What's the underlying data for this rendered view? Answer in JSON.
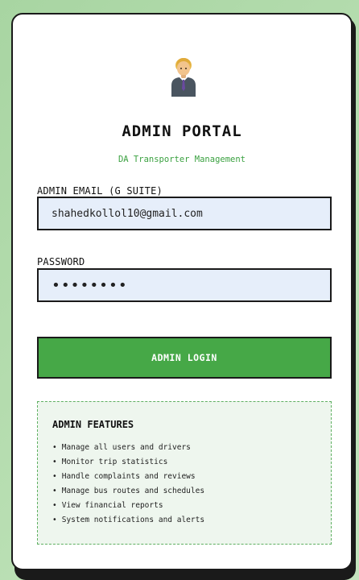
{
  "header": {
    "avatar_icon": "office-worker-icon",
    "title": "ADMIN PORTAL",
    "subtitle": "DA Transporter Management"
  },
  "form": {
    "email_label": "ADMIN EMAIL (G SUITE)",
    "email_value": "shahedkollol10@gmail.com",
    "password_label": "PASSWORD",
    "password_value": "••••••••",
    "login_label": "ADMIN LOGIN"
  },
  "features": {
    "title": "ADMIN FEATURES",
    "items": [
      "Manage all users and drivers",
      "Monitor trip statistics",
      "Handle complaints and reviews",
      "Manage bus routes and schedules",
      "View financial reports",
      "System notifications and alerts"
    ]
  },
  "colors": {
    "accent": "#46a847",
    "subtitle": "#3aa140",
    "input_bg": "#e6eefa",
    "background": "#b9dfb3"
  }
}
